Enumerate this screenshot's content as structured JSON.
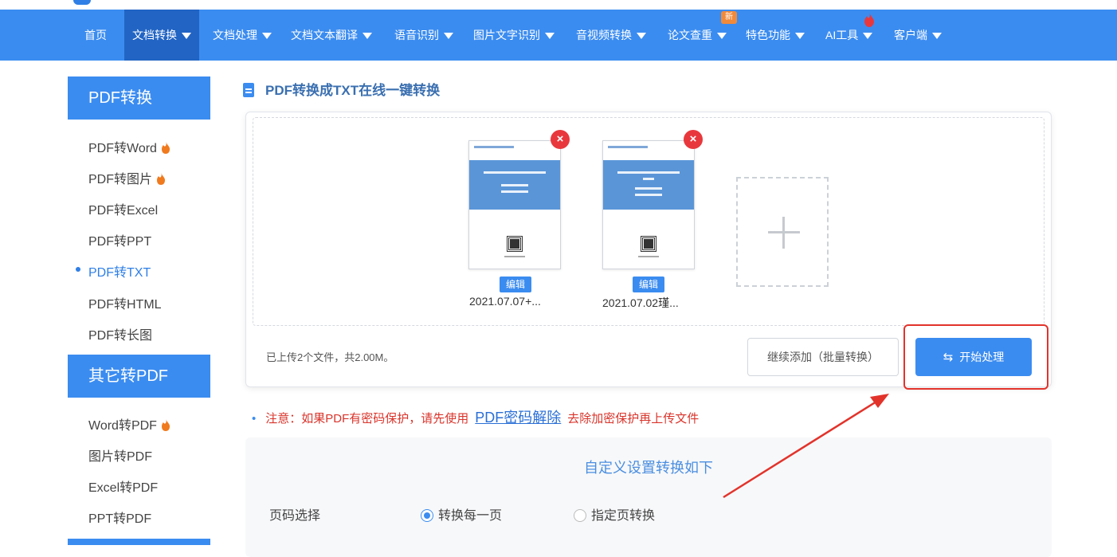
{
  "nav": {
    "items": [
      {
        "label": "首页",
        "dropdown": false
      },
      {
        "label": "文档转换",
        "dropdown": true,
        "active": true
      },
      {
        "label": "文档处理",
        "dropdown": true
      },
      {
        "label": "文档文本翻译",
        "dropdown": true
      },
      {
        "label": "语音识别",
        "dropdown": true
      },
      {
        "label": "图片文字识别",
        "dropdown": true
      },
      {
        "label": "音视频转换",
        "dropdown": true
      },
      {
        "label": "论文查重",
        "dropdown": true
      },
      {
        "label": "特色功能",
        "dropdown": true
      },
      {
        "label": "AI工具",
        "dropdown": true
      },
      {
        "label": "客户端",
        "dropdown": true
      }
    ],
    "new_badge": "新"
  },
  "sidebar": {
    "section1_title": "PDF转换",
    "section1_items": [
      {
        "label": "PDF转Word",
        "hot": true
      },
      {
        "label": "PDF转图片",
        "hot": true
      },
      {
        "label": "PDF转Excel",
        "hot": false
      },
      {
        "label": "PDF转PPT",
        "hot": false
      },
      {
        "label": "PDF转TXT",
        "hot": false,
        "active": true
      },
      {
        "label": "PDF转HTML",
        "hot": false
      },
      {
        "label": "PDF转长图",
        "hot": false
      }
    ],
    "section2_title": "其它转PDF",
    "section2_items": [
      {
        "label": "Word转PDF",
        "hot": true
      },
      {
        "label": "图片转PDF",
        "hot": false
      },
      {
        "label": "Excel转PDF",
        "hot": false
      },
      {
        "label": "PPT转PDF",
        "hot": false
      }
    ]
  },
  "main": {
    "title": "PDF转换成TXT在线一键转换",
    "files": [
      {
        "name": "2021.07.07+...",
        "edit_label": "编辑",
        "remove": "×"
      },
      {
        "name": "2021.07.02瑾...",
        "edit_label": "编辑",
        "remove": "×"
      }
    ],
    "upload_info": "已上传2个文件，共2.00M。",
    "continue_button": "继续添加（批量转换）",
    "start_button": "开始处理",
    "start_icon": "⇆"
  },
  "note": {
    "bullet": "•",
    "prefix": "注意：如果PDF有密码保护，请先使用",
    "link": "PDF密码解除",
    "suffix": "去除加密保护再上传文件"
  },
  "settings": {
    "title": "自定义设置转换如下",
    "page_label": "页码选择",
    "options": [
      {
        "label": "转换每一页",
        "selected": true
      },
      {
        "label": "指定页转换",
        "selected": false
      }
    ]
  },
  "colors": {
    "accent": "#3b8cf0",
    "nav_active": "#2164c4",
    "highlight": "#e2332b",
    "hot": "#f07a1e"
  }
}
